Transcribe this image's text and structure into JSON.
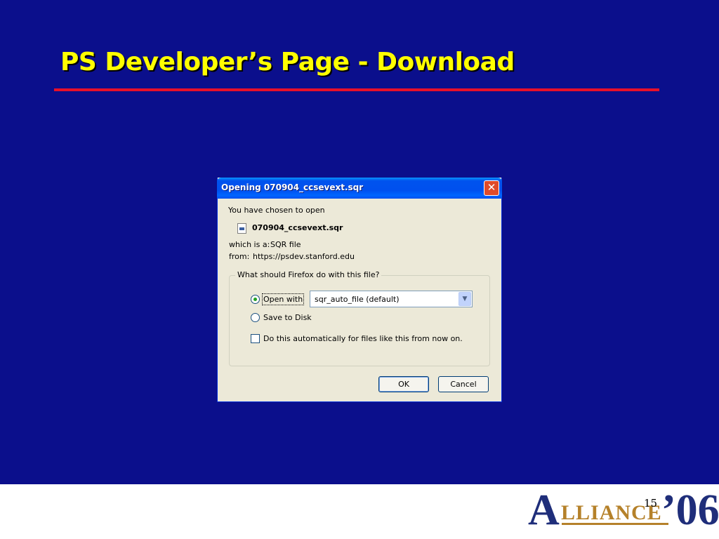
{
  "slide": {
    "title": "PS Developer’s Page - Download",
    "page_number": "15"
  },
  "logo": {
    "first_letter": "A",
    "rest": "LLIANCE",
    "year": "’06"
  },
  "dialog": {
    "title": "Opening 070904_ccsevext.sqr",
    "intro": "You have chosen to open",
    "file_name": "070904_ccsevext.sqr",
    "type_label": "which is a:",
    "type_value": "SQR file",
    "from_label": "from:",
    "from_value": "https://psdev.stanford.edu",
    "group_title": "What should Firefox do with this file?",
    "open_with_label": "Open with",
    "open_with_app": "sqr_auto_file (default)",
    "save_label": "Save to Disk",
    "auto_label": "Do this automatically for files like this from now on.",
    "ok_label": "OK",
    "cancel_label": "Cancel",
    "selected_option": "open_with",
    "auto_checked": false
  },
  "colors": {
    "slide_background": "#0b0f8c",
    "title": "#ffff00",
    "rule": "#e8102a"
  },
  "icons": [
    "close-icon",
    "file-icon",
    "chevron-down-icon"
  ]
}
